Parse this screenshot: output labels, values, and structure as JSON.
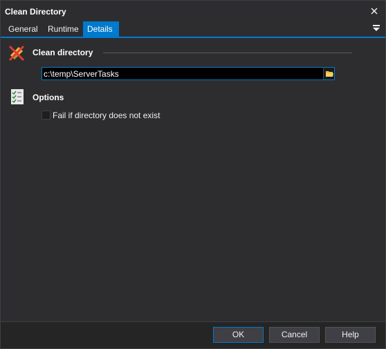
{
  "window": {
    "title": "Clean Directory"
  },
  "tabs": [
    {
      "label": "General",
      "active": false
    },
    {
      "label": "Runtime",
      "active": false
    },
    {
      "label": "Details",
      "active": true
    }
  ],
  "sections": {
    "clean_directory": {
      "label": "Clean directory",
      "icon": "broom-cross-icon"
    },
    "options": {
      "label": "Options",
      "icon": "checklist-icon"
    }
  },
  "path_input": {
    "value": "c:\\temp\\ServerTasks"
  },
  "options": {
    "fail_if_missing": {
      "label": "Fail if directory does not exist",
      "checked": false
    }
  },
  "footer": {
    "ok_label": "OK",
    "cancel_label": "Cancel",
    "help_label": "Help"
  },
  "colors": {
    "accent": "#007acc",
    "background": "#2d2d30",
    "input_bg": "#000000"
  }
}
